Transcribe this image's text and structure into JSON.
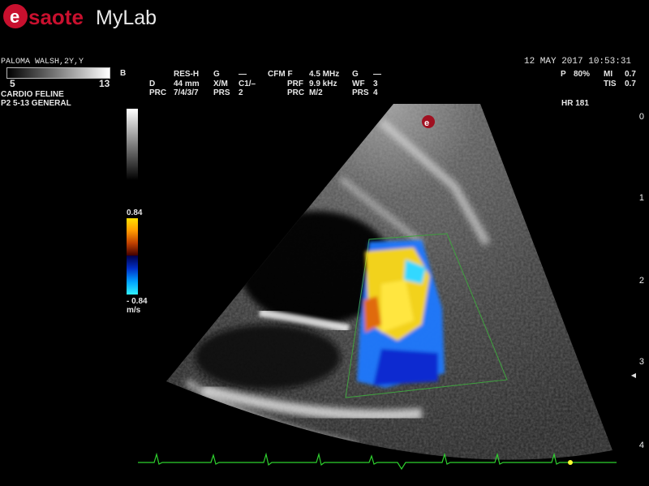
{
  "brand": {
    "logo_main": "esaote",
    "logo_sub": "MyLab"
  },
  "patient": {
    "name": "PALOMA WALSH,2Y,Y",
    "app": "CARDIO FELINE",
    "probe": "P2 5-13  GENERAL"
  },
  "scale": {
    "min": "5",
    "max": "13",
    "mode": "B"
  },
  "bmode": {
    "col1": [
      "RES-H",
      "44 mm",
      "7/4/3/7"
    ],
    "col1_labels": [
      "",
      "D",
      "PRC"
    ],
    "col2_labels": [
      "G",
      "X/M",
      "PRS"
    ],
    "col2": [
      "—",
      "C1/–",
      "2"
    ]
  },
  "cfm": {
    "header": "CFM F",
    "labels": [
      "PRF",
      "PRC"
    ],
    "values": [
      "4.5 MHz",
      "9.9 kHz",
      "M/2"
    ],
    "g_labels": [
      "G",
      "WF",
      "PRS"
    ],
    "g_values": [
      "—",
      "3",
      "4"
    ]
  },
  "datetime": {
    "date": "12  MAY  2017 10:53:31"
  },
  "power": {
    "p_label": "P",
    "p_value": "80%",
    "mi_label": "MI",
    "mi_value": "0.7",
    "tis_label": "TIS",
    "tis_value": "0.7",
    "hr": "HR 181"
  },
  "colorbar": {
    "top": "0.84",
    "bottom": "- 0.84",
    "unit": "m/s"
  },
  "depth": [
    "0",
    "1",
    "2",
    "3",
    "4"
  ]
}
